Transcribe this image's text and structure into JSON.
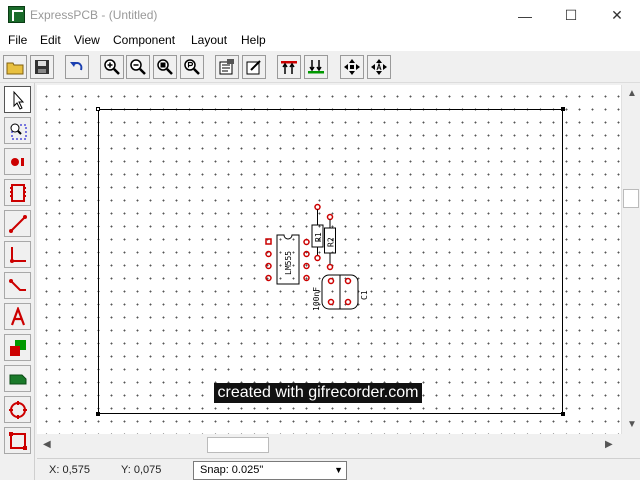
{
  "titlebar": {
    "app_name": "ExpressPCB",
    "document": " - (Untitled)",
    "minimize": "—",
    "maximize": "☐",
    "close": "✕"
  },
  "menu": [
    "File",
    "Edit",
    "View",
    "Component",
    "Layout",
    "Help"
  ],
  "toolbar": {
    "buttons": [
      "open-folder-icon",
      "save-icon",
      "undo-icon",
      "zoom-in-icon",
      "zoom-out-icon",
      "zoom-fit-icon",
      "zoom-previous-icon",
      "properties-icon",
      "edit-component-icon",
      "pads-up-icon",
      "pads-down-icon",
      "move-view-icon",
      "move-anchor-icon"
    ]
  },
  "tools": [
    "select-pointer-icon",
    "select-area-icon",
    "place-pad-icon",
    "place-component-icon",
    "place-trace-icon",
    "place-angle-trace-icon",
    "place-diagonal-trace-icon",
    "place-text-icon",
    "place-fill-icon",
    "place-connector-icon",
    "place-circle-icon",
    "place-rectangle-icon"
  ],
  "components": {
    "ic_label": "LM555",
    "r1_label": "R1",
    "r2_label": "R2",
    "c1_value": "100nF",
    "c1_label": "C1"
  },
  "status": {
    "x": "X: 0,575",
    "y": "Y: 0,075",
    "snap": "Snap:  0.025\""
  },
  "watermark": "created with gifrecorder.com",
  "colors": {
    "pad": "#cc0000",
    "board_outline": "#000000"
  }
}
